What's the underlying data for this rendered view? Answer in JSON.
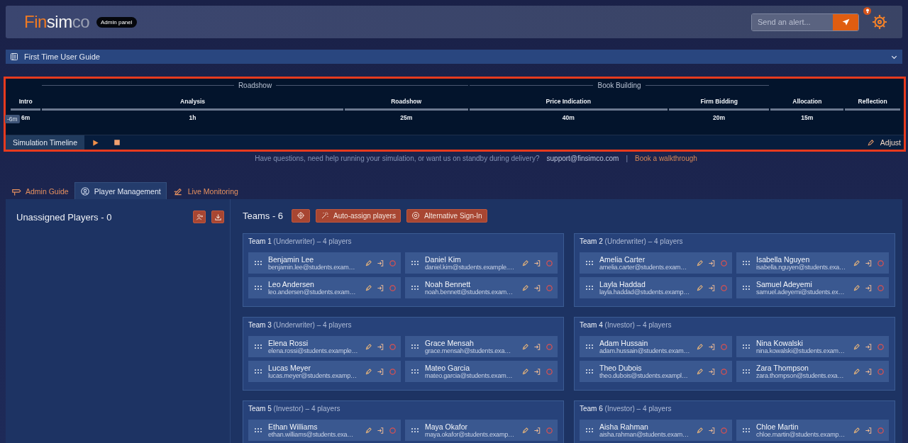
{
  "header": {
    "logo_parts": [
      "Fin",
      "sim",
      "co"
    ],
    "badge": "Admin panel",
    "alert": {
      "placeholder": "Send an alert..."
    }
  },
  "guide": {
    "title": "First Time User Guide",
    "expanded": false
  },
  "timeline": {
    "offset": "-6m",
    "stages": [
      {
        "kind": "phase",
        "label": "Intro",
        "duration": "6m"
      },
      {
        "kind": "group",
        "label": "Roadshow",
        "phases": [
          {
            "label": "Analysis",
            "duration": "1h"
          },
          {
            "label": "Roadshow",
            "duration": "25m"
          }
        ]
      },
      {
        "kind": "group",
        "label": "Book Building",
        "phases": [
          {
            "label": "Price Indication",
            "duration": "40m"
          },
          {
            "label": "Firm Bidding",
            "duration": "20m"
          }
        ]
      },
      {
        "kind": "phase",
        "label": "Allocation",
        "duration": "15m"
      },
      {
        "kind": "phase",
        "label": "Reflection"
      }
    ],
    "bar_label": "Simulation Timeline",
    "adjust": "Adjust"
  },
  "support": {
    "question": "Have questions, need help running your simulation, or want us on standby during delivery?",
    "email": "support@finsimco.com",
    "separator": "|",
    "link": "Book a walkthrough"
  },
  "tabs": [
    {
      "label": "Admin Guide",
      "selected": false
    },
    {
      "label": "Player Management",
      "selected": true
    },
    {
      "label": "Live Monitoring",
      "selected": false
    }
  ],
  "unassigned": {
    "title": "Unassigned Players - 0"
  },
  "teams_header": {
    "title": "Teams - 6",
    "buttons": [
      "Auto-assign players",
      "Alternative Sign-In"
    ]
  },
  "teams": [
    {
      "title": "**Team 1** (Underwriter) – 4 players",
      "players": [
        {
          "name": "Benjamin Lee",
          "email": "benjamin.lee@students.exam…"
        },
        {
          "name": "Daniel Kim",
          "email": "daniel.kim@students.example.…"
        },
        {
          "name": "Leo Andersen",
          "email": "leo.andersen@students.exam…"
        },
        {
          "name": "Noah Bennett",
          "email": "noah.bennett@students.exam…"
        }
      ]
    },
    {
      "title": "**Team 2** (Underwriter) – 4 players",
      "players": [
        {
          "name": "Amelia Carter",
          "email": "amelia.carter@students.exam…"
        },
        {
          "name": "Isabella Nguyen",
          "email": "isabella.nguyen@students.exa…"
        },
        {
          "name": "Layla Haddad",
          "email": "layla.haddad@students.examp…"
        },
        {
          "name": "Samuel Adeyemi",
          "email": "samuel.adeyemi@students.ex…"
        }
      ]
    },
    {
      "title": "**Team 3** (Underwriter) – 4 players",
      "players": [
        {
          "name": "Elena Rossi",
          "email": "elena.rossi@students.example…"
        },
        {
          "name": "Grace Mensah",
          "email": "grace.mensah@students.exa…"
        },
        {
          "name": "Lucas Meyer",
          "email": "lucas.meyer@students.examp…"
        },
        {
          "name": "Mateo Garcia",
          "email": "mateo.garcia@students.exam…"
        }
      ]
    },
    {
      "title": "**Team 4** (Investor) – 4 players",
      "players": [
        {
          "name": "Adam Hussain",
          "email": "adam.hussain@students.exam…"
        },
        {
          "name": "Nina Kowalski",
          "email": "nina.kowalski@students.exam…"
        },
        {
          "name": "Theo Dubois",
          "email": "theo.dubois@students.exampl…"
        },
        {
          "name": "Zara Thompson",
          "email": "zara.thompson@students.exa…"
        }
      ]
    },
    {
      "title": "**Team 5** (Investor) – 4 players",
      "players": [
        {
          "name": "Ethan Williams",
          "email": "ethan.williams@students.exa…"
        },
        {
          "name": "Maya Okafor",
          "email": "maya.okafor@students.examp…"
        }
      ]
    },
    {
      "title": "**Team 6** (Investor) – 4 players",
      "players": [
        {
          "name": "Aisha Rahman",
          "email": "aisha.rahman@students.exam…"
        },
        {
          "name": "Chloe Martin",
          "email": "chloe.martin@students.examp…"
        }
      ]
    }
  ]
}
